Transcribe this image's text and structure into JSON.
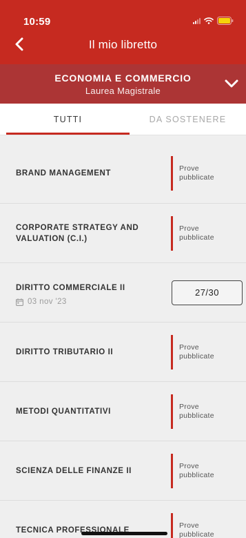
{
  "status_bar": {
    "time": "10:59"
  },
  "nav": {
    "title": "Il mio libretto"
  },
  "course": {
    "name": "ECONOMIA E COMMERCIO",
    "type": "Laurea Magistrale"
  },
  "tabs": [
    {
      "label": "TUTTI",
      "active": true
    },
    {
      "label": "DA SOSTENERE",
      "active": false
    }
  ],
  "exams": [
    {
      "name": "BRAND MANAGEMENT",
      "status": "Prove pubblicate",
      "grade": null,
      "date": null
    },
    {
      "name": "CORPORATE STRATEGY AND VALUATION (C.I.)",
      "status": "Prove pubblicate",
      "grade": null,
      "date": null
    },
    {
      "name": "DIRITTO COMMERCIALE II",
      "status": null,
      "grade": "27/30",
      "date": "03 nov '23"
    },
    {
      "name": "DIRITTO TRIBUTARIO II",
      "status": "Prove pubblicate",
      "grade": null,
      "date": null
    },
    {
      "name": "METODI QUANTITATIVI",
      "status": "Prove pubblicate",
      "grade": null,
      "date": null
    },
    {
      "name": "SCIENZA DELLE FINANZE II",
      "status": "Prove pubblicate",
      "grade": null,
      "date": null
    },
    {
      "name": "TECNICA PROFESSIONALE",
      "status": "Prove pubblicate",
      "grade": null,
      "date": null
    }
  ],
  "colors": {
    "header": "#c62a20",
    "course_bar": "#ac3535",
    "accent": "#c62a20",
    "background": "#efefef"
  },
  "icons": {
    "back": "chevron-left-icon",
    "expand": "chevron-down-icon",
    "date": "calendar-icon"
  }
}
